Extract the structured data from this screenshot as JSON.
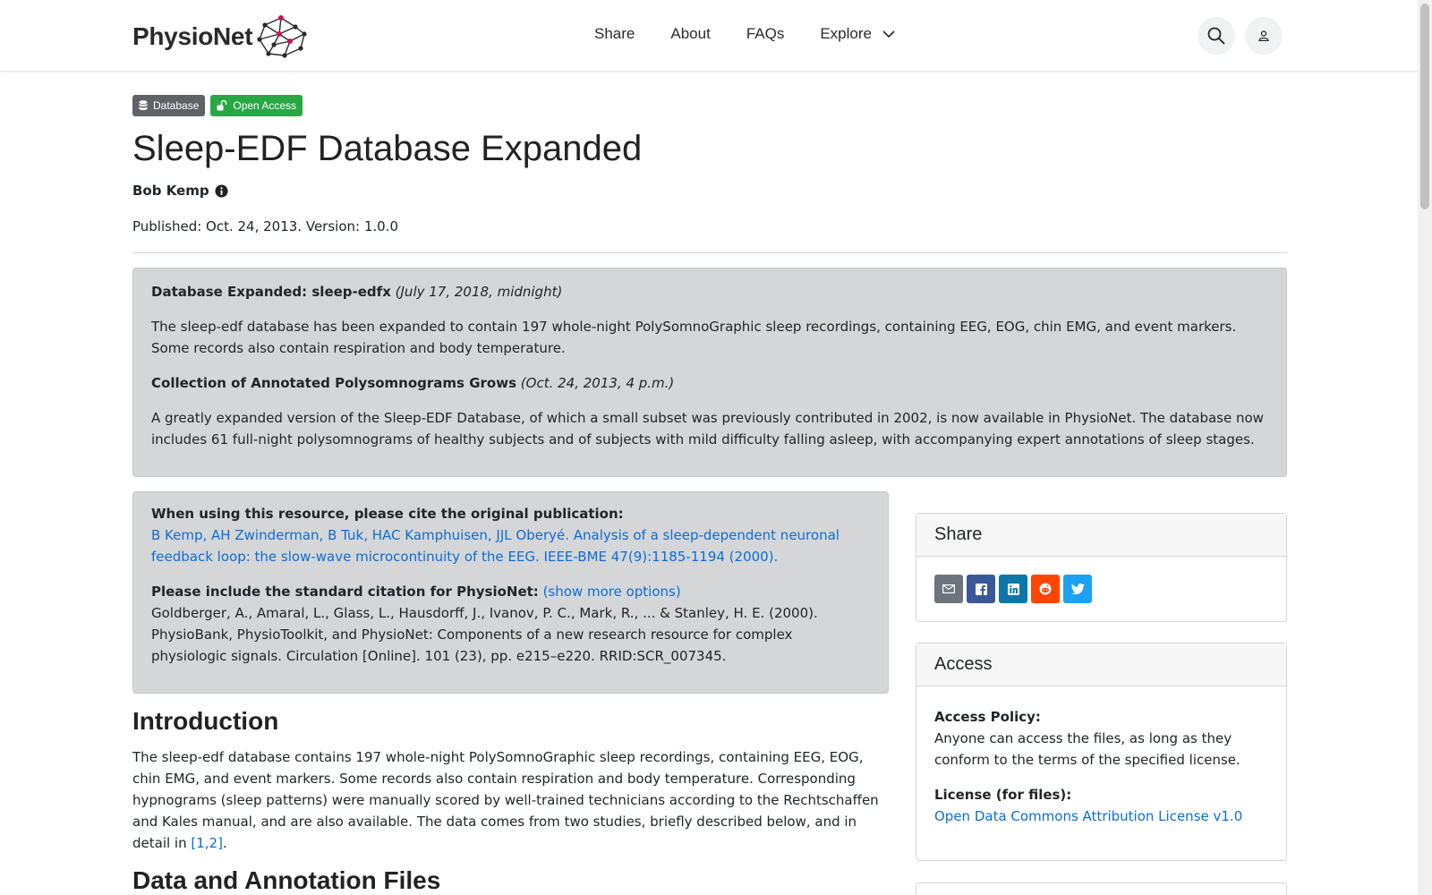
{
  "header": {
    "logo_text": "PhysioNet",
    "nav": [
      {
        "label": "Share"
      },
      {
        "label": "About"
      },
      {
        "label": "FAQs"
      },
      {
        "label": "Explore"
      }
    ]
  },
  "badges": {
    "type": "Database",
    "access": "Open Access"
  },
  "project": {
    "title": "Sleep-EDF Database Expanded",
    "author": "Bob Kemp",
    "published": "Published: Oct. 24, 2013. Version: 1.0.0"
  },
  "news": [
    {
      "heading": "Database Expanded: sleep-edfx",
      "date": "(July 17, 2018, midnight)",
      "body": "The sleep-edf database has been expanded to contain 197 whole-night PolySomnoGraphic sleep recordings, containing EEG, EOG, chin EMG, and event markers. Some records also contain respiration and body temperature."
    },
    {
      "heading": "Collection of Annotated Polysomnograms Grows",
      "date": "(Oct. 24, 2013, 4 p.m.)",
      "body": "A greatly expanded version of the Sleep-EDF Database, of which a small subset was previously contributed in 2002, is now available in PhysioNet. The database now includes 61 full-night polysomnograms of healthy subjects and of subjects with mild difficulty falling asleep, with accompanying expert annotations of sleep stages."
    }
  ],
  "citation": {
    "original_label": "When using this resource, please cite the original publication:",
    "original_link": "B Kemp, AH Zwinderman, B Tuk, HAC Kamphuisen, JJL Oberyé. Analysis of a sleep-dependent neuronal feedback loop: the slow-wave microcontinuity of the EEG. IEEE-BME 47(9):1185-1194 (2000).",
    "standard_label": "Please include the standard citation for PhysioNet:",
    "show_more": "(show more options)",
    "standard_text": "Goldberger, A., Amaral, L., Glass, L., Hausdorff, J., Ivanov, P. C., Mark, R., ... & Stanley, H. E. (2000). PhysioBank, PhysioToolkit, and PhysioNet: Components of a new research resource for complex physiologic signals. Circulation [Online]. 101 (23), pp. e215–e220. RRID:SCR_007345."
  },
  "intro": {
    "heading": "Introduction",
    "body": "The sleep-edf database contains 197 whole-night PolySomnoGraphic sleep recordings, containing EEG, EOG, chin EMG, and event markers. Some records also contain respiration and body temperature. Corresponding hypnograms (sleep patterns) were manually scored by well-trained technicians according to the Rechtschaffen and Kales manual, and are also available. The data comes from two studies, briefly described below, and in detail in",
    "ref": "[1,2]",
    "end": "."
  },
  "data_section": {
    "heading": "Data and Annotation Files"
  },
  "sidebar": {
    "share_title": "Share",
    "share_buttons": [
      {
        "icon": "email-icon",
        "color": "#6c757d"
      },
      {
        "icon": "facebook-icon",
        "color": "#3b5998"
      },
      {
        "icon": "linkedin-icon",
        "color": "#0e76a8"
      },
      {
        "icon": "reddit-icon",
        "color": "#ff4500"
      },
      {
        "icon": "twitter-icon",
        "color": "#1da1f2"
      }
    ],
    "access_title": "Access",
    "access_policy_label": "Access Policy:",
    "access_policy_text": "Anyone can access the files, as long as they conform to the terms of the specified license.",
    "license_label": "License (for files):",
    "license_link": "Open Data Commons Attribution License v1.0"
  }
}
